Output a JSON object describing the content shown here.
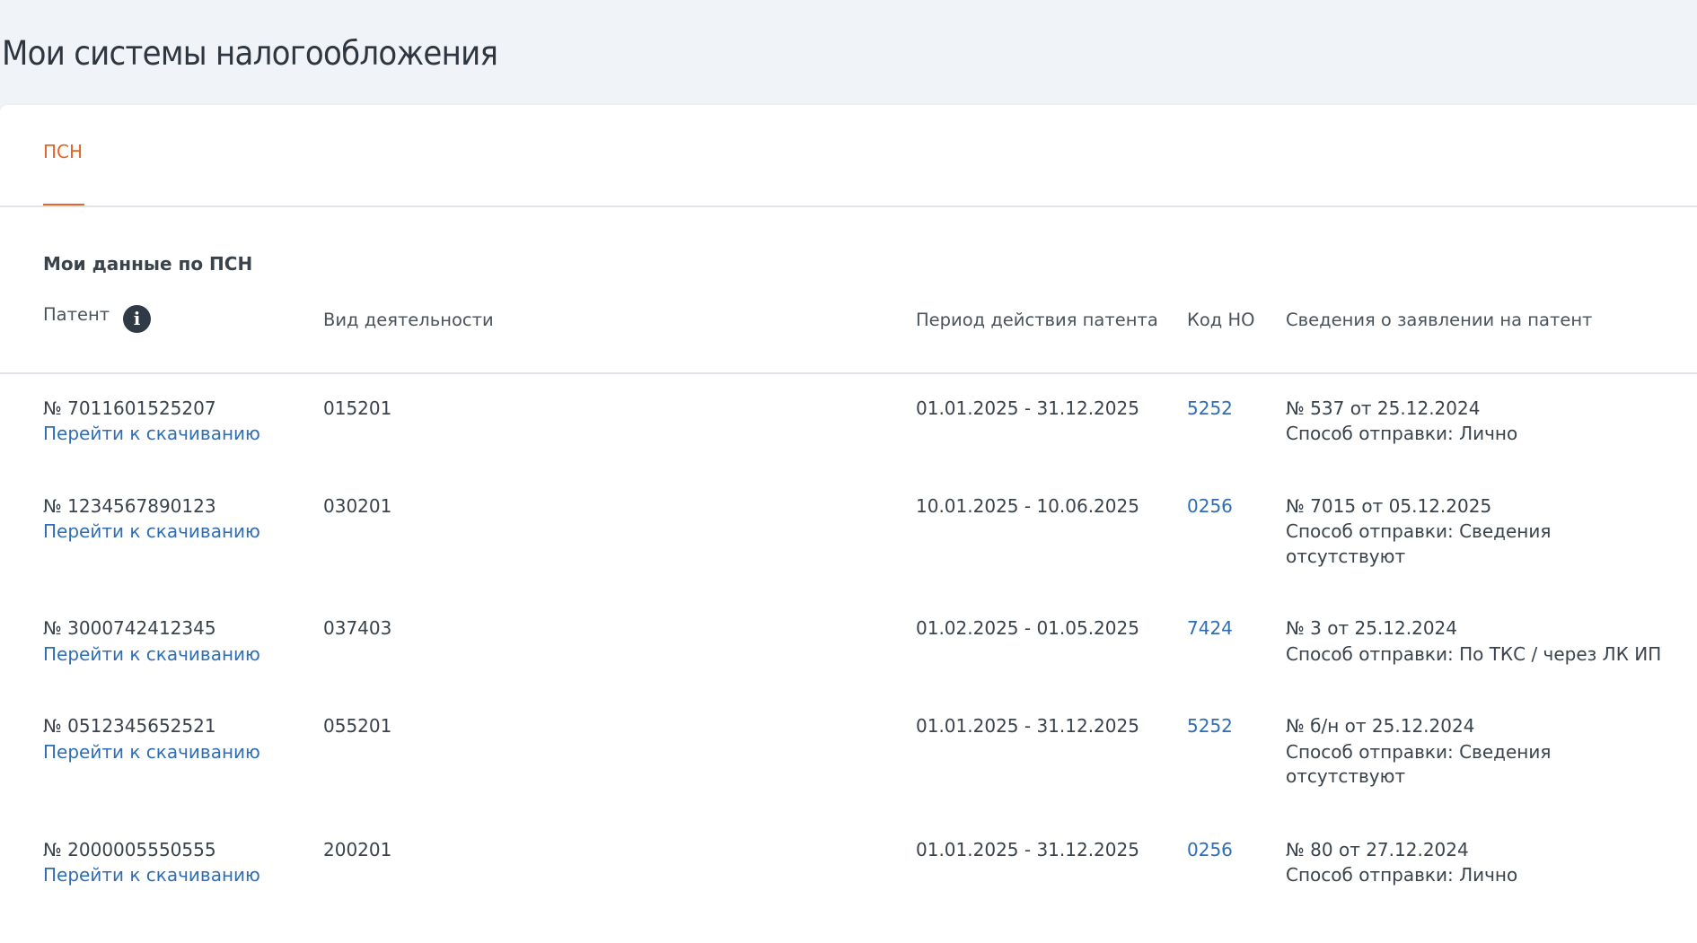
{
  "page": {
    "title": "Мои системы налогообложения"
  },
  "tabs": [
    {
      "label": "ПСН",
      "active": true
    }
  ],
  "section": {
    "title": "Мои данные по ПСН"
  },
  "columns": {
    "patent": "Патент",
    "activity": "Вид деятельности",
    "period": "Период действия патента",
    "tax_office": "Код НО",
    "application": "Сведения о заявлении на патент"
  },
  "icons": {
    "info": "info-icon",
    "info_glyph": "i"
  },
  "colors": {
    "accent": "#e0662b",
    "link": "#2f6db5",
    "background": "#f0f3f7"
  },
  "rows": [
    {
      "number": "№ 7011601525207",
      "download": "Перейти к скачиванию",
      "activity": "015201",
      "period": "01.01.2025 - 31.12.2025",
      "code": "5252",
      "app_number": "№ 537 от 25.12.2024",
      "method_line1": "Способ отправки: Лично",
      "method_line2": ""
    },
    {
      "number": "№ 1234567890123",
      "download": "Перейти к скачиванию",
      "activity": "030201",
      "period": "10.01.2025 - 10.06.2025",
      "code": "0256",
      "app_number": "№ 7015 от 05.12.2025",
      "method_line1": "Способ отправки: Сведения",
      "method_line2": "отсутствуют"
    },
    {
      "number": "№ 3000742412345",
      "download": "Перейти к скачиванию",
      "activity": "037403",
      "period": "01.02.2025 - 01.05.2025",
      "code": "7424",
      "app_number": "№ 3 от 25.12.2024",
      "method_line1": "Способ отправки: По ТКС / через ЛК ИП",
      "method_line2": ""
    },
    {
      "number": "№ 0512345652521",
      "download": "Перейти к скачиванию",
      "activity": "055201",
      "period": "01.01.2025 - 31.12.2025",
      "code": "5252",
      "app_number": "№ б/н от 25.12.2024",
      "method_line1": "Способ отправки: Сведения",
      "method_line2": "отсутствуют"
    },
    {
      "number": "№ 2000005550555",
      "download": "Перейти к скачиванию",
      "activity": "200201",
      "period": "01.01.2025 - 31.12.2025",
      "code": "0256",
      "app_number": "№ 80 от 27.12.2024",
      "method_line1": "Способ отправки: Лично",
      "method_line2": ""
    }
  ]
}
